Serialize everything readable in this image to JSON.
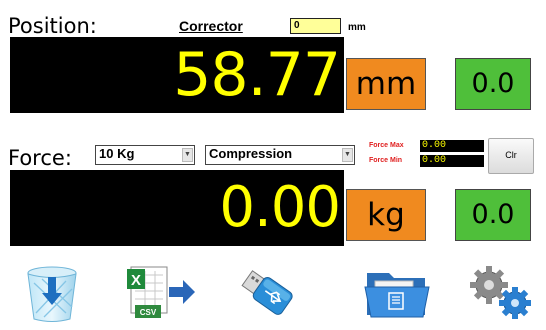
{
  "position": {
    "label": "Position:",
    "corrector_label": "Corrector",
    "corrector_value": "0",
    "corrector_unit": "mm",
    "reading": "58.77",
    "unit_button": "mm",
    "zero_button": "0.0"
  },
  "force": {
    "label": "Force:",
    "capacity_selected": "10 Kg",
    "mode_selected": "Compression",
    "force_max_label": "Force Max",
    "force_max_value": "0.00",
    "force_min_label": "Force Min",
    "force_min_value": "0.00",
    "clear_button": "Clr",
    "reading": "0.00",
    "unit_button": "kg",
    "zero_button": "0.0"
  },
  "toolbar": {
    "items": [
      {
        "icon": "recycle-bin-icon"
      },
      {
        "icon": "excel-csv-export-icon",
        "badge": "CSV",
        "letter": "X"
      },
      {
        "icon": "usb-drive-icon"
      },
      {
        "icon": "open-folder-icon"
      },
      {
        "icon": "settings-gears-icon"
      }
    ]
  },
  "colors": {
    "display_bg": "#000000",
    "display_text": "#ffff00",
    "unit_button": "#f08a1f",
    "zero_button": "#4fbf3a",
    "corrector_bg": "#ffff99",
    "force_limits_label": "#e02020"
  }
}
